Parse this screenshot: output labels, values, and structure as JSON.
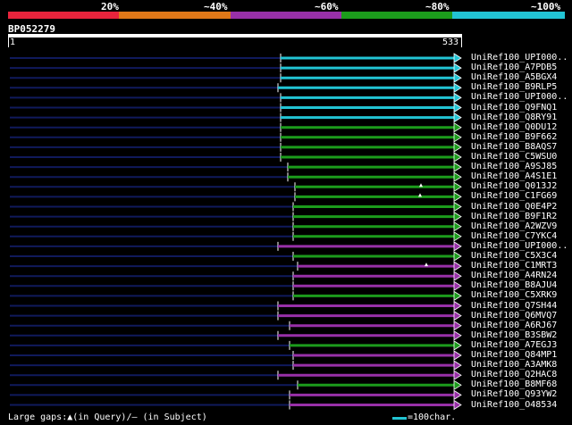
{
  "legend": {
    "segments": [
      {
        "label": "20%",
        "color": "#e8243c"
      },
      {
        "label": "~40%",
        "color": "#e07818"
      },
      {
        "label": "~60%",
        "color": "#9830a8"
      },
      {
        "label": "~80%",
        "color": "#1c9c1c"
      },
      {
        "label": "~100%",
        "color": "#22c4d4"
      }
    ]
  },
  "query": {
    "id": "BP052279",
    "start": "1",
    "end": "533"
  },
  "hits": [
    {
      "label": "UniRef100_UPI000..",
      "color": "#22c4d4"
    },
    {
      "label": "UniRef100_A7PDB5",
      "color": "#22c4d4"
    },
    {
      "label": "UniRef100_A5BGX4",
      "color": "#22c4d4"
    },
    {
      "label": "UniRef100_B9RLP5",
      "color": "#22c4d4"
    },
    {
      "label": "UniRef100_UPI000..",
      "color": "#22c4d4"
    },
    {
      "label": "UniRef100_Q9FNQ1",
      "color": "#22c4d4"
    },
    {
      "label": "UniRef100_Q8RY91",
      "color": "#22c4d4"
    },
    {
      "label": "UniRef100_Q0DU12",
      "color": "#1c9c1c"
    },
    {
      "label": "UniRef100_B9F662",
      "color": "#1c9c1c"
    },
    {
      "label": "UniRef100_B8AQS7",
      "color": "#1c9c1c"
    },
    {
      "label": "UniRef100_C5WSU0",
      "color": "#1c9c1c"
    },
    {
      "label": "UniRef100_A9SJ85",
      "color": "#1c9c1c"
    },
    {
      "label": "UniRef100_A4S1E1",
      "color": "#1c9c1c"
    },
    {
      "label": "UniRef100_Q013J2",
      "color": "#1c9c1c"
    },
    {
      "label": "UniRef100_C1FG69",
      "color": "#1c9c1c"
    },
    {
      "label": "UniRef100_Q0E4P2",
      "color": "#1c9c1c"
    },
    {
      "label": "UniRef100_B9F1R2",
      "color": "#1c9c1c"
    },
    {
      "label": "UniRef100_A2WZV9",
      "color": "#1c9c1c"
    },
    {
      "label": "UniRef100_C7YKC4",
      "color": "#1c9c1c"
    },
    {
      "label": "UniRef100_UPI000..",
      "color": "#9830a8"
    },
    {
      "label": "UniRef100_C5X3C4",
      "color": "#1c9c1c"
    },
    {
      "label": "UniRef100_C1MRT3",
      "color": "#9830a8"
    },
    {
      "label": "UniRef100_A4RN24",
      "color": "#9830a8"
    },
    {
      "label": "UniRef100_B8AJU4",
      "color": "#9830a8"
    },
    {
      "label": "UniRef100_C5XRK9",
      "color": "#1c9c1c"
    },
    {
      "label": "UniRef100_Q7SH44",
      "color": "#9830a8"
    },
    {
      "label": "UniRef100_Q6MVQ7",
      "color": "#9830a8"
    },
    {
      "label": "UniRef100_A6RJ67",
      "color": "#9830a8"
    },
    {
      "label": "UniRef100_B3SBW2",
      "color": "#9830a8"
    },
    {
      "label": "UniRef100_A7EGJ3",
      "color": "#1c9c1c"
    },
    {
      "label": "UniRef100_Q84MP1",
      "color": "#9830a8"
    },
    {
      "label": "UniRef100_A3AMK8",
      "color": "#9830a8"
    },
    {
      "label": "UniRef100_Q2HAC8",
      "color": "#9830a8"
    },
    {
      "label": "UniRef100_B8MF68",
      "color": "#1c9c1c"
    },
    {
      "label": "UniRef100_Q93YW2",
      "color": "#9830a8"
    },
    {
      "label": "UniRef100_O48534",
      "color": "#9830a8"
    }
  ],
  "footer": {
    "gaps_text": "Large gaps:▲(in Query)/— (in Subject)",
    "scale_text": "=100char."
  }
}
